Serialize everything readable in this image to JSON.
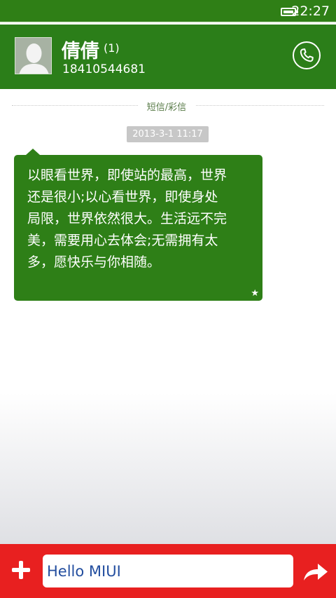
{
  "status_bar": {
    "time": "22:27",
    "battery_icon": "battery-full-icon"
  },
  "header": {
    "contact_name": "倩倩",
    "unread_badge": "(1)",
    "phone_number": "18410544681",
    "avatar_icon": "person-silhouette-icon",
    "call_icon": "phone-call-icon"
  },
  "conversation": {
    "section_label": "短信/彩信",
    "messages": [
      {
        "timestamp": "2013-3-1 11:17",
        "lines": [
          "以眼看世界，即使站的最高，世界",
          "还是很小;以心看世界，即使身处",
          "局限，世界依然很大。生活远不完",
          "美，需要用心去体会;无需拥有太",
          "多，愿快乐与你相随。"
        ],
        "star_icon": "star-icon"
      }
    ]
  },
  "composer": {
    "input_value": "Hello MIUI",
    "add_icon": "plus-icon",
    "send_icon": "send-arrow-icon"
  },
  "colors": {
    "header_green": "#2b7e19",
    "bubble_green": "#2e7f17",
    "composer_red": "#e82020",
    "input_text_blue": "#234e9f"
  }
}
